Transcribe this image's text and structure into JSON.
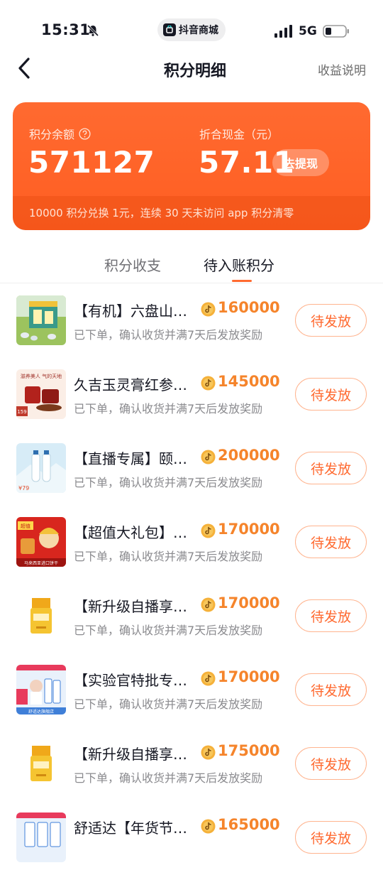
{
  "status_bar": {
    "time": "15:31",
    "app_name": "抖音商城",
    "network": "5G"
  },
  "nav": {
    "title": "积分明细",
    "right_link": "收益说明"
  },
  "summary": {
    "balance_label": "积分余额",
    "balance_value": "571127",
    "cash_label": "折合现金（元）",
    "cash_value": "57.11",
    "withdraw_label": "去提现",
    "footnote": "10000 积分兑换 1元，连续 30 天未访问 app 积分清零",
    "accent_color": "#ff6a30"
  },
  "tabs": [
    {
      "label": "积分收支",
      "active": false
    },
    {
      "label": "待入账积分",
      "active": true
    }
  ],
  "items": [
    {
      "title": "【有机】六盘山…",
      "points": "160000",
      "desc": "已下单，确认收货并满7天后发放奖励",
      "button": "待发放",
      "thumb": "green-box"
    },
    {
      "title": "久吉玉灵膏红参…",
      "points": "145000",
      "desc": "已下单，确认收货并满7天后发放奖励",
      "button": "待发放",
      "thumb": "red-jar",
      "thumb_text": "滋养美人 气的天地",
      "thumb_tag": "159"
    },
    {
      "title": "【直播专属】颐…",
      "points": "200000",
      "desc": "已下单，确认收货并满7天后发放奖励",
      "button": "待发放",
      "thumb": "white-bottles",
      "thumb_tag": "¥79"
    },
    {
      "title": "【超值大礼包】…",
      "points": "170000",
      "desc": "已下单，确认收货并满7天后发放奖励",
      "button": "待发放",
      "thumb": "red-gift",
      "thumb_text": "马来西亚进口饼干",
      "thumb_tag": "超值"
    },
    {
      "title": "【新升级自播享…",
      "points": "170000",
      "desc": "已下单，确认收货并满7天后发放奖励",
      "button": "待发放",
      "thumb": "yellow-jar"
    },
    {
      "title": "【实验官特批专…",
      "points": "170000",
      "desc": "已下单，确认收货并满7天后发放奖励",
      "button": "待发放",
      "thumb": "blue-pack",
      "thumb_text": "舒适达旗舰店"
    },
    {
      "title": "【新升级自播享…",
      "points": "175000",
      "desc": "已下单，确认收货并满7天后发放奖励",
      "button": "待发放",
      "thumb": "yellow-jar"
    },
    {
      "title": "舒适达【年货节…",
      "points": "165000",
      "desc": "",
      "button": "待发放",
      "thumb": "blue-pack"
    }
  ]
}
